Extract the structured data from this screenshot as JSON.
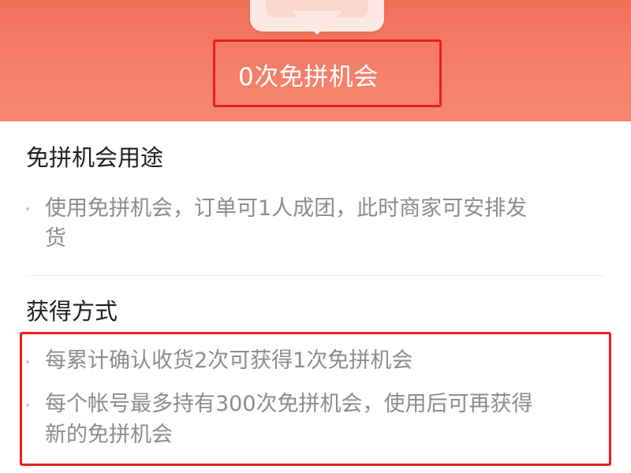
{
  "header": {
    "chance_count_label": "0次免拼机会"
  },
  "usage": {
    "title": "免拼机会用途",
    "items": [
      {
        "line1": "使用免拼机会，订单可1人成团，此时商家可安排发",
        "line2": "货"
      }
    ]
  },
  "obtain": {
    "title": "获得方式",
    "items": [
      {
        "line1": "每累计确认收货2次可获得1次免拼机会"
      },
      {
        "line1": "每个帐号最多持有300次免拼机会，使用后可再获得",
        "line2": "新的免拼机会"
      }
    ]
  },
  "colors": {
    "header_bg": "#f2705a",
    "highlight_border": "#e8201a",
    "title_text": "#1f1f1f",
    "body_text": "#8c8c8c"
  }
}
